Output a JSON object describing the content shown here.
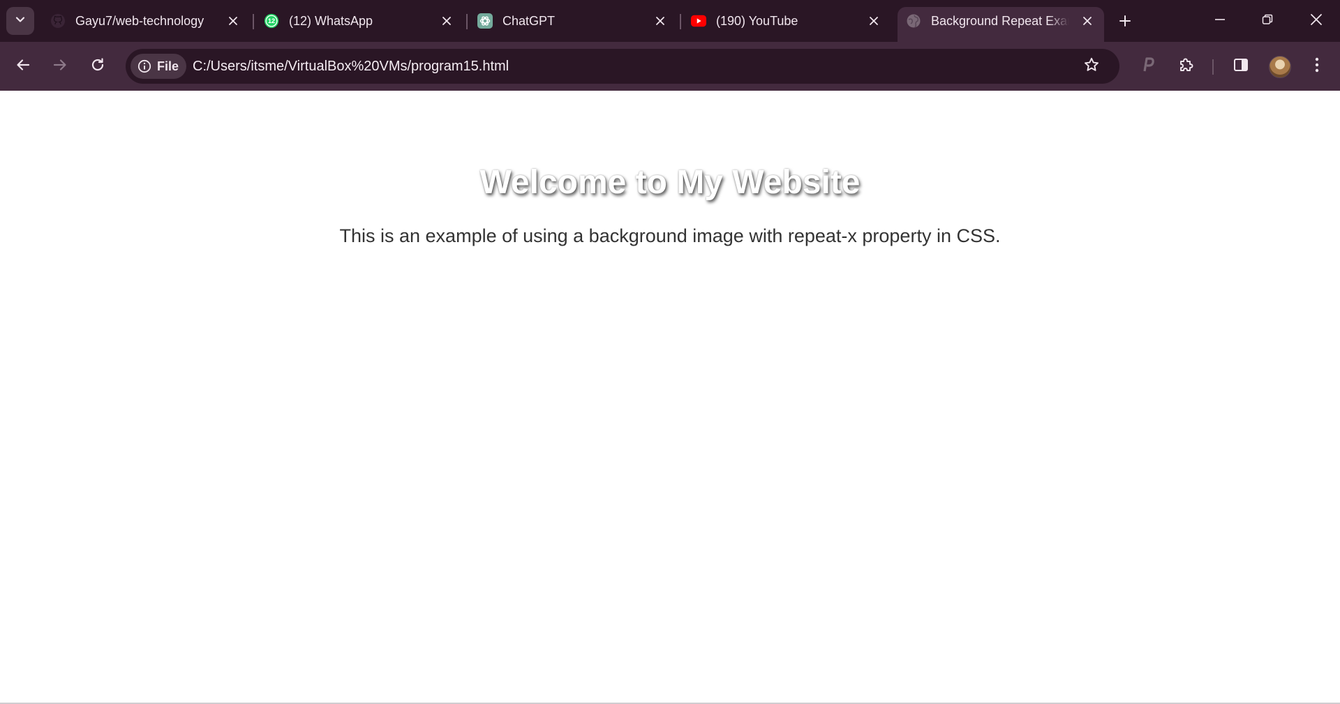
{
  "browser": {
    "tabs": [
      {
        "title": "Gayu7/web-technology",
        "favicon": "github-icon",
        "active": false
      },
      {
        "title": "(12) WhatsApp",
        "favicon": "whatsapp-icon",
        "badge": "12",
        "active": false
      },
      {
        "title": "ChatGPT",
        "favicon": "chatgpt-icon",
        "active": false
      },
      {
        "title": "(190) YouTube",
        "favicon": "youtube-icon",
        "active": false
      },
      {
        "title": "Background Repeat Example",
        "favicon": "globe-icon",
        "active": true
      }
    ],
    "site_chip_label": "File",
    "url": "C:/Users/itsme/VirtualBox%20VMs/program15.html",
    "colors": {
      "tabstrip": "#2a1625",
      "toolbar": "#432a3e",
      "omnibox": "#2a1625",
      "whatsapp": "#25d366",
      "youtube": "#ff0000",
      "chatgpt": "#74aa9c"
    }
  },
  "page": {
    "heading": "Welcome to My Website",
    "paragraph": "This is an example of using a background image with repeat-x property in CSS."
  }
}
